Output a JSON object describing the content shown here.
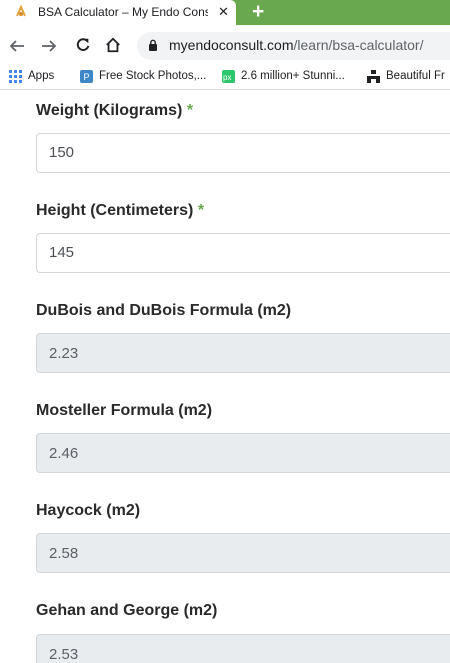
{
  "browser": {
    "tab_title": "BSA Calculator – My Endo Consu",
    "tab_close_icon": "close-icon",
    "new_tab_icon": "plus-icon",
    "url_host": "myendoconsult.com",
    "url_path": "/learn/bsa-calculator/",
    "colors": {
      "tabstrip": "#6aa84f",
      "accent": "#6aa84f"
    },
    "bookmarks": [
      {
        "label": "Apps",
        "icon": "apps-grid-icon"
      },
      {
        "label": "Free Stock Photos,...",
        "icon": "pexels-icon"
      },
      {
        "label": "2.6 million+ Stunni...",
        "icon": "pixabay-icon"
      },
      {
        "label": "Beautiful Fr",
        "icon": "unsplash-icon"
      }
    ]
  },
  "form": {
    "weight": {
      "label": "Weight (Kilograms)",
      "required_mark": "*",
      "value": "150"
    },
    "height": {
      "label": "Height (Centimeters)",
      "required_mark": "*",
      "value": "145"
    },
    "dubois": {
      "label": "DuBois and DuBois Formula (m2)",
      "value": "2.23"
    },
    "mosteller": {
      "label": "Mosteller Formula (m2)",
      "value": "2.46"
    },
    "haycock": {
      "label": "Haycock (m2)",
      "value": "2.58"
    },
    "gehan": {
      "label": "Gehan and George (m2)",
      "value": "2.53"
    }
  }
}
